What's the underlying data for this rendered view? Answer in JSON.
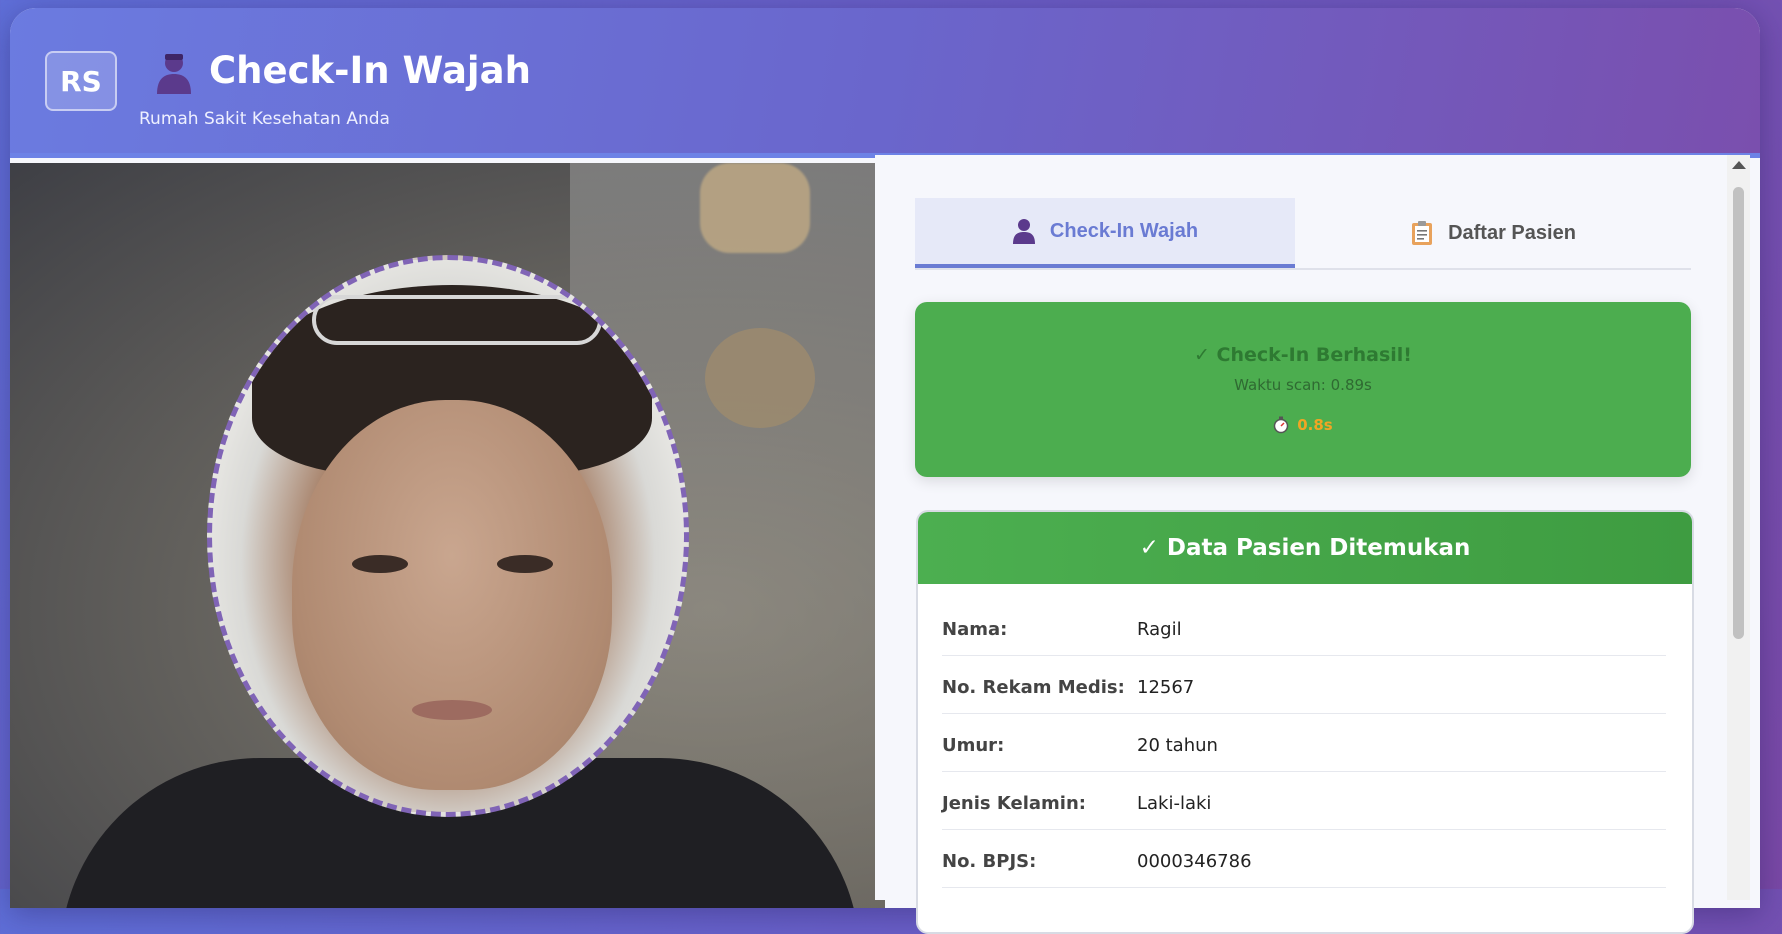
{
  "header": {
    "logo_text": "RS",
    "title": "Check-In Wajah",
    "subtitle": "Rumah Sakit Kesehatan Anda",
    "title_icon": "person-icon"
  },
  "camera": {
    "overlay_icon": "face-guide-oval",
    "accent": "#8064b6"
  },
  "tabs": [
    {
      "label": "Check-In Wajah",
      "icon": "person-icon",
      "active": true
    },
    {
      "label": "Daftar Pasien",
      "icon": "clipboard-icon",
      "active": false
    }
  ],
  "status": {
    "title": "✓ Check-In Berhasil!",
    "scan_time": "Waktu scan: 0.89s",
    "timer_icon": "stopwatch-icon",
    "timer_value": "0.8s",
    "color": "#4cad4f"
  },
  "patient": {
    "header": "✓ Data Pasien Ditemukan",
    "rows": [
      {
        "label": "Nama:",
        "value": "Ragil"
      },
      {
        "label": "No. Rekam Medis:",
        "value": "12567"
      },
      {
        "label": "Umur:",
        "value": "20 tahun"
      },
      {
        "label": "Jenis Kelamin:",
        "value": "Laki-laki"
      },
      {
        "label": "No. BPJS:",
        "value": "0000346786"
      }
    ]
  }
}
